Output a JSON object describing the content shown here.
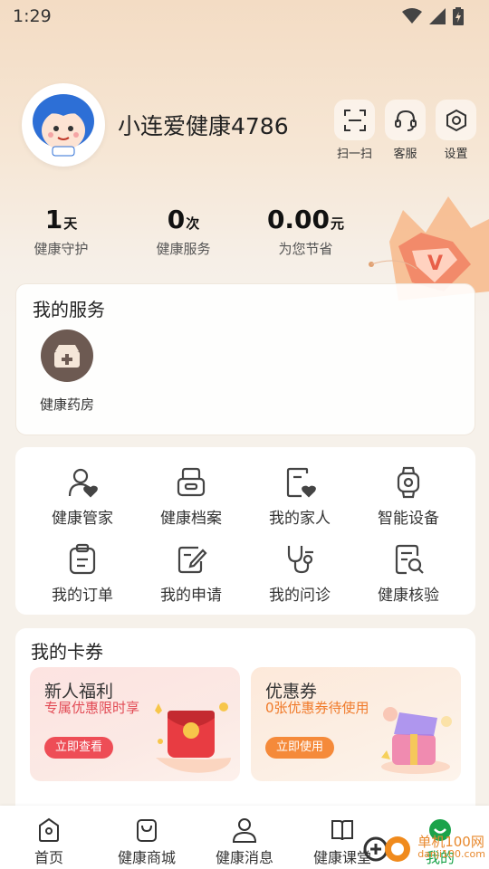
{
  "status_bar": {
    "time": "1:29"
  },
  "profile": {
    "username": "小连爱健康4786"
  },
  "top_actions": [
    {
      "label": "扫一扫",
      "icon": "scan-icon"
    },
    {
      "label": "客服",
      "icon": "headset-icon"
    },
    {
      "label": "设置",
      "icon": "settings-icon"
    }
  ],
  "stats": [
    {
      "value": "1",
      "unit": "天",
      "label": "健康守护"
    },
    {
      "value": "0",
      "unit": "次",
      "label": "健康服务"
    },
    {
      "value": "0.00",
      "unit": "元",
      "label": "为您节省"
    }
  ],
  "my_services": {
    "title": "我的服务",
    "items": [
      {
        "label": "健康药房",
        "icon": "pharmacy-box-icon"
      }
    ]
  },
  "feature_grid": [
    {
      "label": "健康管家",
      "icon": "health-butler-icon"
    },
    {
      "label": "健康档案",
      "icon": "health-record-icon"
    },
    {
      "label": "我的家人",
      "icon": "family-icon"
    },
    {
      "label": "智能设备",
      "icon": "smartwatch-icon"
    },
    {
      "label": "我的订单",
      "icon": "order-icon"
    },
    {
      "label": "我的申请",
      "icon": "application-icon"
    },
    {
      "label": "我的问诊",
      "icon": "stethoscope-icon"
    },
    {
      "label": "健康核验",
      "icon": "verification-icon"
    }
  ],
  "cards": {
    "title": "我的卡券",
    "coupons": [
      {
        "title": "新人福利",
        "subtitle": "专属优惠限时享",
        "button": "立即查看"
      },
      {
        "title": "优惠券",
        "subtitle": "0张优惠券待使用",
        "button": "立即使用"
      }
    ]
  },
  "tabbar": [
    {
      "label": "首页",
      "icon": "home-icon",
      "active": false
    },
    {
      "label": "健康商城",
      "icon": "shopping-bag-icon",
      "active": false
    },
    {
      "label": "健康消息",
      "icon": "user-message-icon",
      "active": false
    },
    {
      "label": "健康课堂",
      "icon": "book-icon",
      "active": false
    },
    {
      "label": "我的",
      "icon": "me-icon",
      "active": true
    }
  ],
  "watermark": {
    "line1": "单机100网",
    "line2": "danji100.com"
  },
  "colors": {
    "accent_green": "#1aa34a",
    "coupon_red": "#ee4d56",
    "coupon_orange": "#f58a3a"
  }
}
